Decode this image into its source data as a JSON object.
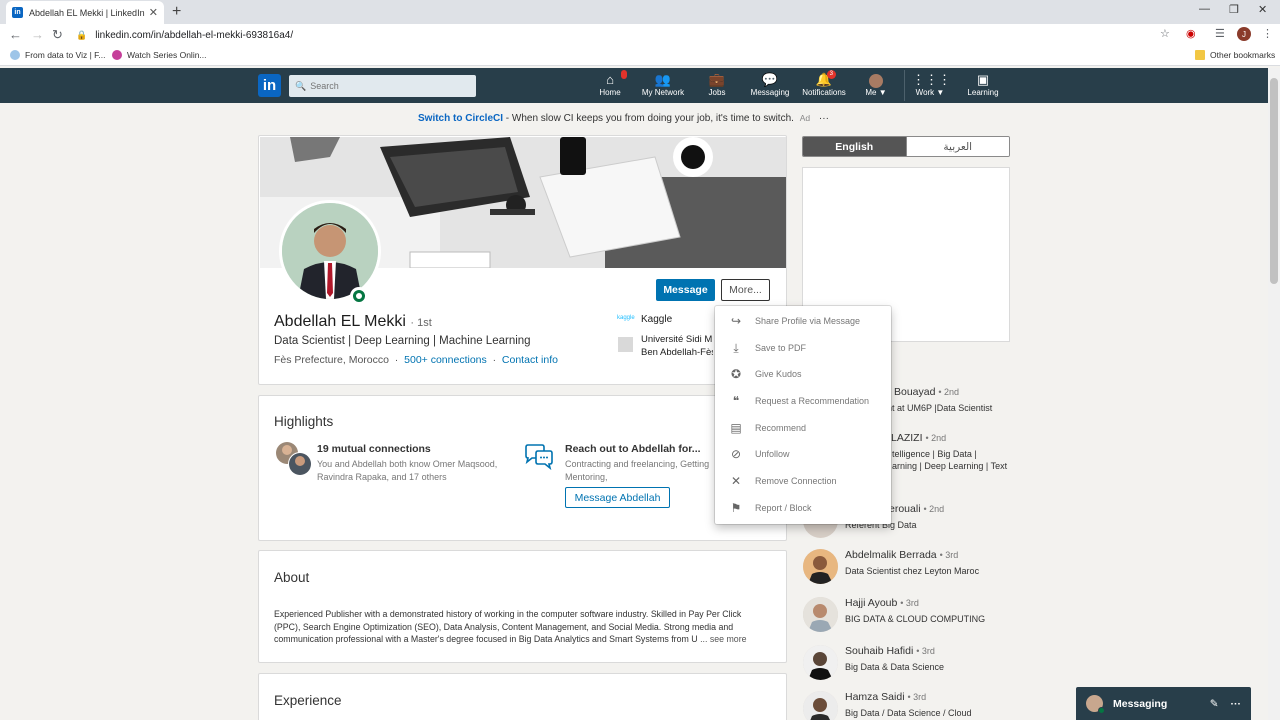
{
  "browser": {
    "tab_title": "Abdellah EL Mekki | LinkedIn",
    "url": "linkedin.com/in/abdellah-el-mekki-693816a4/",
    "bookmarks": [
      "From data to Viz | F...",
      "Watch Series Onlin..."
    ],
    "other_bookmarks": "Other bookmarks",
    "profile_initial": "J"
  },
  "nav": {
    "search_placeholder": "Search",
    "items": [
      {
        "label": "Home",
        "icon": "home-icon",
        "badge": ""
      },
      {
        "label": "My Network",
        "icon": "network-icon",
        "badge": ""
      },
      {
        "label": "Jobs",
        "icon": "briefcase-icon",
        "badge": ""
      },
      {
        "label": "Messaging",
        "icon": "chat-icon",
        "badge": ""
      },
      {
        "label": "Notifications",
        "icon": "bell-icon",
        "badge": "3"
      },
      {
        "label": "Me ▼",
        "icon": "avatar-icon",
        "badge": ""
      },
      {
        "label": "Work ▼",
        "icon": "grid-icon",
        "badge": ""
      },
      {
        "label": "Learning",
        "icon": "play-icon",
        "badge": ""
      }
    ]
  },
  "ad": {
    "link": "Switch to CircleCI",
    "text": " - When slow CI keeps you from doing your job, it's time to switch.",
    "tag": "Ad"
  },
  "profile": {
    "name": "Abdellah EL Mekki",
    "degree": "· 1st",
    "headline": "Data Scientist | Deep Learning | Machine Learning",
    "location": "Fès Prefecture, Morocco",
    "connections": "500+ connections",
    "contact": "Contact info",
    "company_logo_text": "kaggle",
    "company": "Kaggle",
    "school_line1": "Université Sidi M",
    "school_line2": "Ben Abdellah-Fès",
    "message_button": "Message",
    "more_button": "More..."
  },
  "highlights": {
    "title": "Highlights",
    "mutual_title": "19 mutual connections",
    "mutual_sub": "You and Abdellah both know Omer Maqsood, Ravindra Rapaka, and 17 others",
    "reach_title": "Reach out to Abdellah for...",
    "reach_sub": "Contracting and freelancing, Getting Mentoring,",
    "message_cta": "Message Abdellah"
  },
  "about": {
    "title": "About",
    "text": "Experienced Publisher with a demonstrated history of working in the computer software industry. Skilled in Pay Per Click (PPC), Search Engine Optimization (SEO), Data Analysis, Content Management, and Social Media. Strong media and communication professional with a Master's degree focused in Big Data Analytics and Smart Systems from U",
    "see_more": "... see more"
  },
  "experience": {
    "title": "Experience"
  },
  "right_rail": {
    "lang_en": "English",
    "lang_ar": "العربية",
    "people_header_fragment": "d",
    "people": [
      {
        "name": "Bouayad",
        "degree": "• 2nd",
        "desc": "nt at UM6P |Data Scientist"
      },
      {
        "name": "LAZIZI",
        "degree": "• 2nd",
        "desc": "telligence | Big Data |",
        "desc2": "arning | Deep Learning | Text"
      },
      {
        "name": "erouali",
        "degree": "• 2nd",
        "desc": "Référent Big Data"
      },
      {
        "name": "Abdelmalik Berrada",
        "degree": "• 3rd",
        "desc": "Data Scientist chez Leyton Maroc"
      },
      {
        "name": "Hajji Ayoub",
        "degree": "• 3rd",
        "desc": "BIG DATA & CLOUD COMPUTING"
      },
      {
        "name": "Souhaib Hafidi",
        "degree": "• 3rd",
        "desc": "Big Data & Data Science"
      },
      {
        "name": "Hamza Saidi",
        "degree": "• 3rd",
        "desc": "Big Data / Data Science / Cloud"
      }
    ]
  },
  "dropdown": [
    {
      "label": "Share Profile via Message",
      "icon": "share-icon",
      "glyph": "↪"
    },
    {
      "label": "Save to PDF",
      "icon": "download-icon",
      "glyph": "⤓"
    },
    {
      "label": "Give Kudos",
      "icon": "award-icon",
      "glyph": "✪"
    },
    {
      "label": "Request a Recommendation",
      "icon": "quote-icon",
      "glyph": "❝"
    },
    {
      "label": "Recommend",
      "icon": "comment-icon",
      "glyph": "▤"
    },
    {
      "label": "Unfollow",
      "icon": "block-icon",
      "glyph": "⊘"
    },
    {
      "label": "Remove Connection",
      "icon": "remove-person-icon",
      "glyph": "✕"
    },
    {
      "label": "Report / Block",
      "icon": "flag-icon",
      "glyph": "⚑"
    }
  ],
  "messaging_bar": {
    "label": "Messaging"
  },
  "colors": {
    "linkedin_blue": "#0a66c2",
    "header_bg": "#283e4a",
    "button_blue": "#0073b1"
  }
}
